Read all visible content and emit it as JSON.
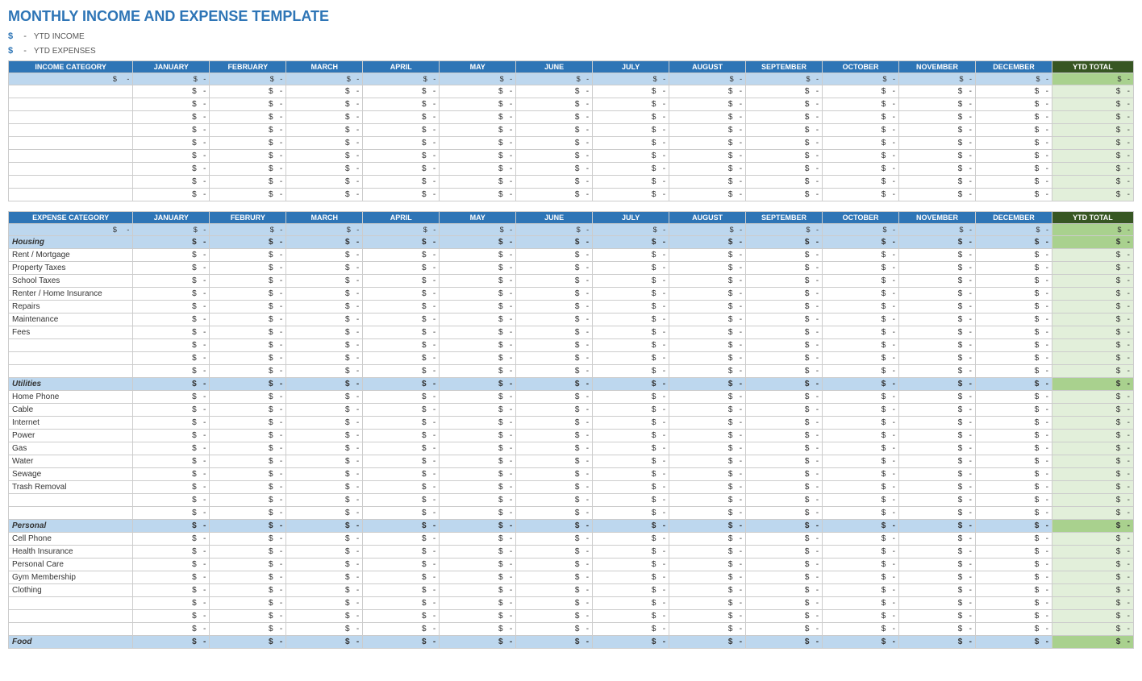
{
  "title": "MONTHLY INCOME AND EXPENSE TEMPLATE",
  "ytd_income_label": "YTD INCOME",
  "ytd_expenses_label": "YTD EXPENSES",
  "dollar_sign": "$",
  "months": [
    "JANUARY",
    "FEBRUARY",
    "MARCH",
    "APRIL",
    "MAY",
    "JUNE",
    "JULY",
    "AUGUST",
    "SEPTEMBER",
    "OCTOBER",
    "NOVEMBER",
    "DECEMBER"
  ],
  "months_expense": [
    "JANUARY",
    "FEBRURY",
    "MARCH",
    "APRIL",
    "MAY",
    "JUNE",
    "JULY",
    "AUGUST",
    "SEPTEMBER",
    "OCTOBER",
    "NOVEMBER",
    "DECEMBER"
  ],
  "ytd_total_label": "YTD TOTAL",
  "income_category_label": "INCOME CATEGORY",
  "expense_category_label": "EXPENSE CATEGORY",
  "income_rows": [
    {
      "name": "",
      "vals": [
        "-",
        "-",
        "-",
        "-",
        "-",
        "-",
        "-",
        "-",
        "-",
        "-",
        "-",
        "-",
        "-"
      ]
    },
    {
      "name": "",
      "vals": [
        "-",
        "-",
        "-",
        "-",
        "-",
        "-",
        "-",
        "-",
        "-",
        "-",
        "-",
        "-",
        "-"
      ]
    },
    {
      "name": "",
      "vals": [
        "-",
        "-",
        "-",
        "-",
        "-",
        "-",
        "-",
        "-",
        "-",
        "-",
        "-",
        "-",
        "-"
      ]
    },
    {
      "name": "",
      "vals": [
        "-",
        "-",
        "-",
        "-",
        "-",
        "-",
        "-",
        "-",
        "-",
        "-",
        "-",
        "-",
        "-"
      ]
    },
    {
      "name": "",
      "vals": [
        "-",
        "-",
        "-",
        "-",
        "-",
        "-",
        "-",
        "-",
        "-",
        "-",
        "-",
        "-",
        "-"
      ]
    },
    {
      "name": "",
      "vals": [
        "-",
        "-",
        "-",
        "-",
        "-",
        "-",
        "-",
        "-",
        "-",
        "-",
        "-",
        "-",
        "-"
      ]
    },
    {
      "name": "",
      "vals": [
        "-",
        "-",
        "-",
        "-",
        "-",
        "-",
        "-",
        "-",
        "-",
        "-",
        "-",
        "-",
        "-"
      ]
    },
    {
      "name": "",
      "vals": [
        "-",
        "-",
        "-",
        "-",
        "-",
        "-",
        "-",
        "-",
        "-",
        "-",
        "-",
        "-",
        "-"
      ]
    },
    {
      "name": "",
      "vals": [
        "-",
        "-",
        "-",
        "-",
        "-",
        "-",
        "-",
        "-",
        "-",
        "-",
        "-",
        "-",
        "-"
      ]
    }
  ],
  "expense_sections": [
    {
      "section_name": "Housing",
      "rows": [
        {
          "name": "Rent / Mortgage"
        },
        {
          "name": "Property Taxes"
        },
        {
          "name": "School Taxes"
        },
        {
          "name": "Renter / Home Insurance"
        },
        {
          "name": "Repairs"
        },
        {
          "name": "Maintenance"
        },
        {
          "name": "Fees"
        },
        {
          "name": ""
        },
        {
          "name": ""
        },
        {
          "name": ""
        }
      ]
    },
    {
      "section_name": "Utilities",
      "rows": [
        {
          "name": "Home Phone"
        },
        {
          "name": "Cable"
        },
        {
          "name": "Internet"
        },
        {
          "name": "Power"
        },
        {
          "name": "Gas"
        },
        {
          "name": "Water"
        },
        {
          "name": "Sewage"
        },
        {
          "name": "Trash Removal"
        },
        {
          "name": ""
        },
        {
          "name": ""
        }
      ]
    },
    {
      "section_name": "Personal",
      "rows": [
        {
          "name": "Cell Phone"
        },
        {
          "name": "Health Insurance"
        },
        {
          "name": "Personal Care"
        },
        {
          "name": "Gym Membership"
        },
        {
          "name": "Clothing"
        },
        {
          "name": ""
        },
        {
          "name": ""
        },
        {
          "name": ""
        }
      ]
    },
    {
      "section_name": "Food",
      "rows": []
    }
  ]
}
